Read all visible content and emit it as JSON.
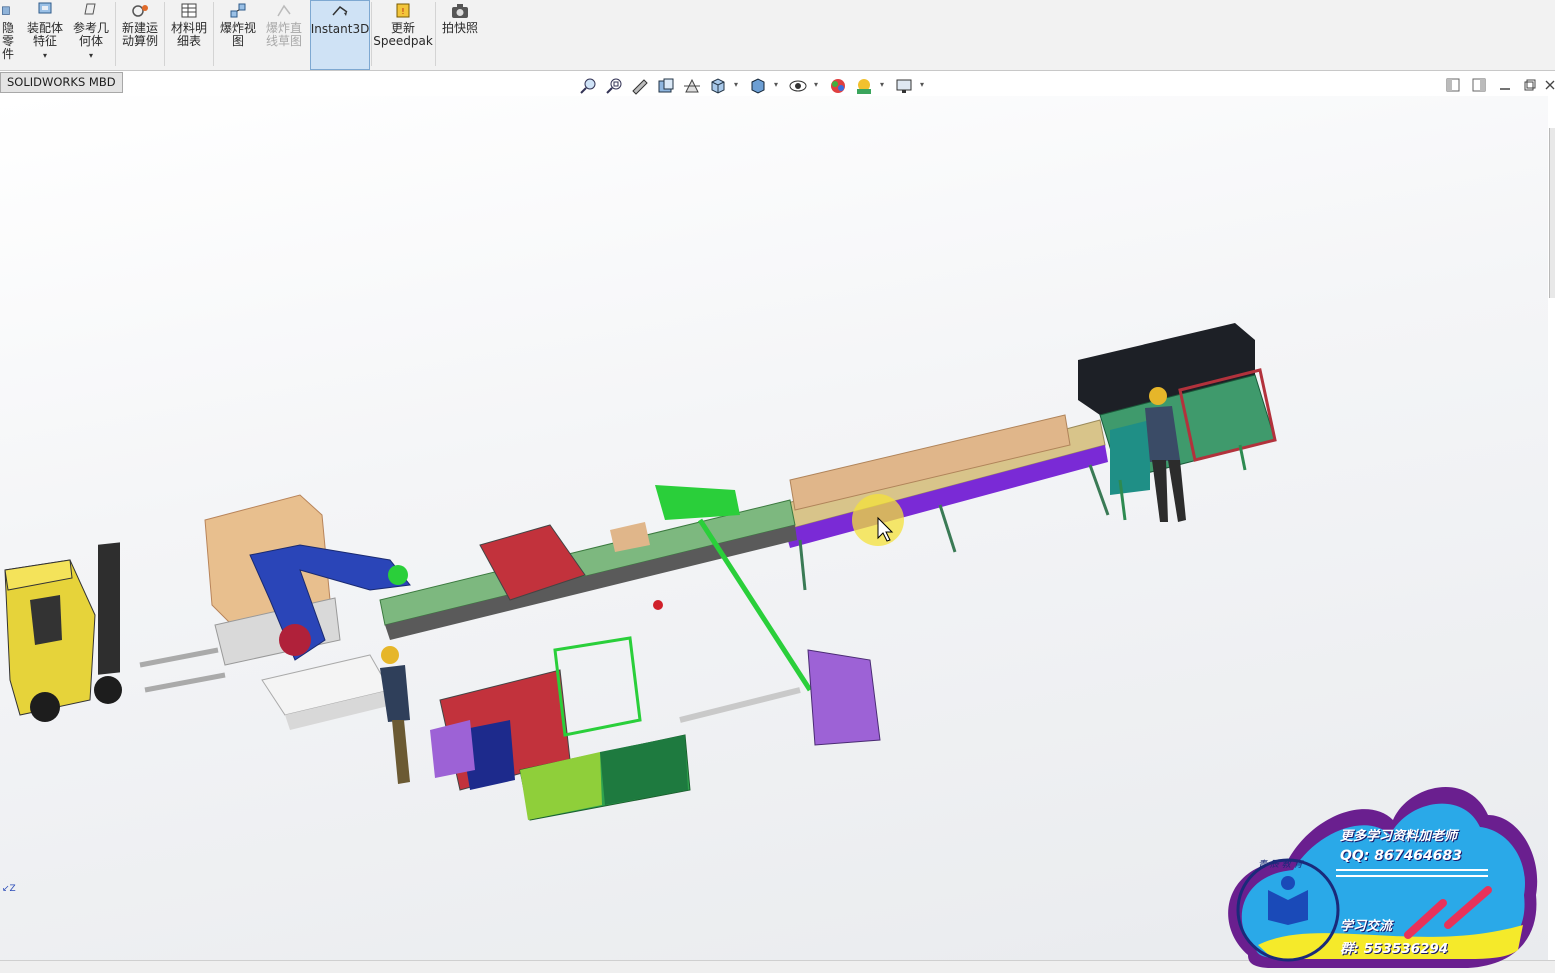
{
  "ribbon": {
    "items": [
      {
        "label": "隐\n零\n件",
        "name": "show-hide-components-button",
        "disabled": false,
        "has_dropdown": false
      },
      {
        "label": "装配体\n特征",
        "name": "assembly-features-button",
        "disabled": false,
        "has_dropdown": true
      },
      {
        "label": "参考几\n何体",
        "name": "reference-geometry-button",
        "disabled": false,
        "has_dropdown": true
      },
      {
        "label": "新建运\n动算例",
        "name": "new-motion-study-button",
        "disabled": false,
        "has_dropdown": false
      },
      {
        "label": "材料明\n细表",
        "name": "bill-of-materials-button",
        "disabled": false,
        "has_dropdown": false
      },
      {
        "label": "爆炸视\n图",
        "name": "exploded-view-button",
        "disabled": false,
        "has_dropdown": false
      },
      {
        "label": "爆炸直\n线草图",
        "name": "explode-line-sketch-button",
        "disabled": true,
        "has_dropdown": false
      },
      {
        "label": "Instant3D",
        "name": "instant3d-button",
        "disabled": false,
        "has_dropdown": false,
        "active": true
      },
      {
        "label": "更新\nSpeedpak",
        "name": "update-speedpak-button",
        "disabled": false,
        "has_dropdown": false
      },
      {
        "label": "拍快照",
        "name": "take-snapshot-button",
        "disabled": false,
        "has_dropdown": false
      }
    ]
  },
  "tabs": {
    "mbd": "SOLIDWORKS MBD"
  },
  "hud_icons": [
    "zoom-to-fit-icon",
    "zoom-to-area-icon",
    "previous-view-icon",
    "section-view-icon",
    "dynamic-annotation-icon",
    "view-orientation-icon",
    "display-style-icon",
    "hide-show-items-icon",
    "edit-appearance-icon",
    "apply-scene-icon",
    "view-settings-icon"
  ],
  "triad": {
    "axis_label": "Z"
  },
  "watermark": {
    "line1": "更多学习资料加老师",
    "line2": "QQ: 867464683",
    "line3": "学习交流",
    "line4": "群: 553536294",
    "logo_text": "青 辰 教 育"
  },
  "colors": {
    "ribbon_bg": "#f2f2f2",
    "active_button": "#cfe2f5",
    "badge_purple": "#6a1f8f",
    "badge_blue": "#2aa9e8",
    "badge_yellow": "#f5ea2a"
  }
}
